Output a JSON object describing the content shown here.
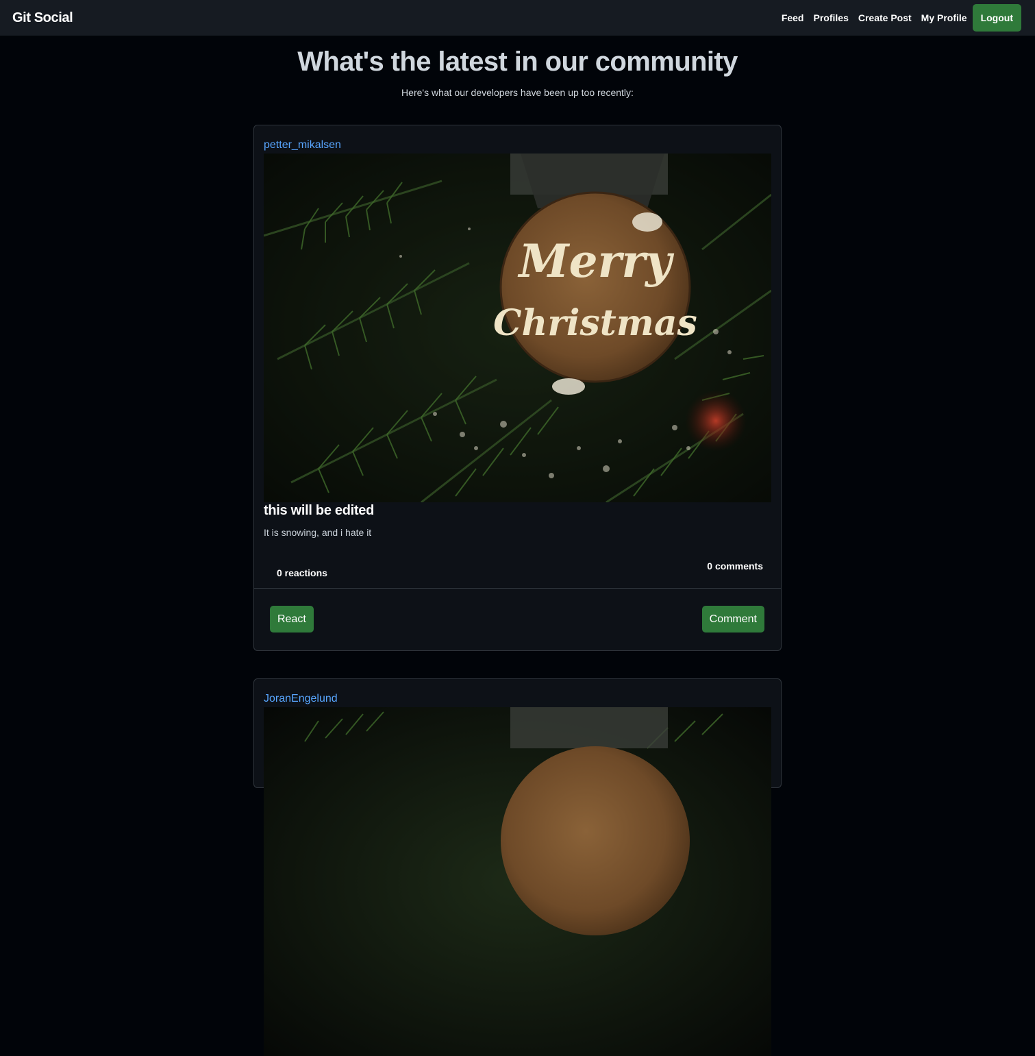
{
  "navbar": {
    "brand": "Git Social",
    "links": [
      {
        "label": "Feed"
      },
      {
        "label": "Profiles"
      },
      {
        "label": "Create Post"
      },
      {
        "label": "My Profile"
      }
    ],
    "logout_label": "Logout"
  },
  "hero": {
    "title": "What's the latest in our community",
    "subtitle": "Here's what our developers have been up too recently:"
  },
  "posts": [
    {
      "author": "petter_mikalsen",
      "image_text": [
        "Merry",
        "Christmas"
      ],
      "title": "this will be edited",
      "body": "It is snowing, and i hate it",
      "reactions": "0 reactions",
      "comments": "0 comments",
      "react_label": "React",
      "comment_label": "Comment"
    },
    {
      "author": "JoranEngelund"
    }
  ],
  "colors": {
    "page_bg": "#010409",
    "navbar_bg": "#161b22",
    "card_bg": "#0d1117",
    "accent_green": "#2f7a3a",
    "link_blue": "#58a6ff"
  }
}
